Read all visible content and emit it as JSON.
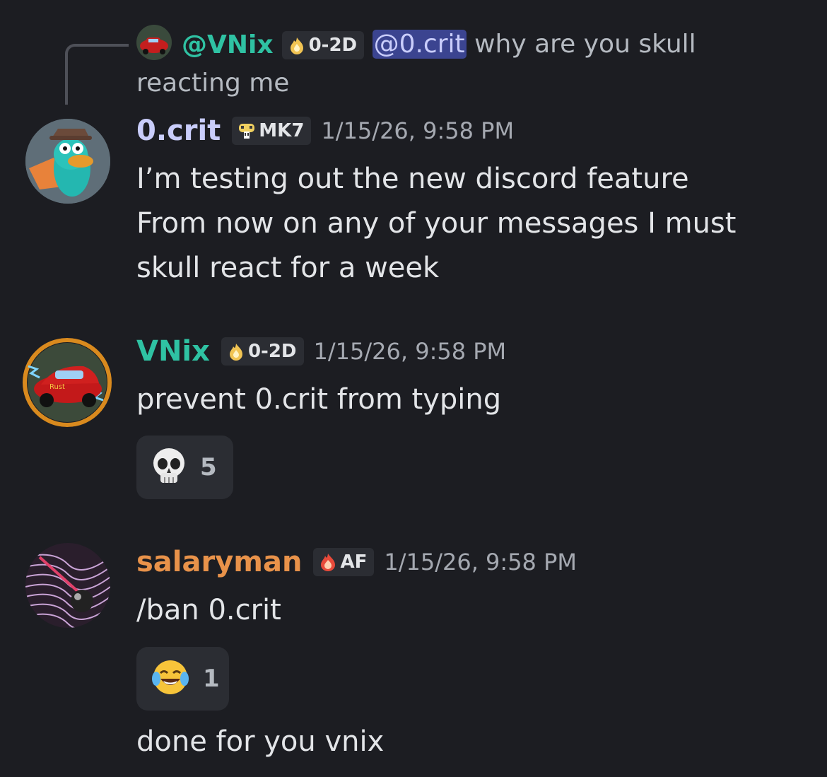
{
  "reply": {
    "author": "@VNix",
    "tag": "0-2D",
    "mention": "@0.crit",
    "text": " why are you skull reacting me"
  },
  "messages": [
    {
      "author": "0.crit",
      "author_color": "#c9cdfb",
      "tag": "MK7",
      "tag_icon": "mushroom-icon",
      "timestamp": "1/15/26, 9:58 PM",
      "lines": [
        "I’m testing out the new discord feature",
        "From now on any of your messages I must",
        "skull react for a week"
      ]
    },
    {
      "author": "VNix",
      "author_color": "#2fc2a3",
      "tag": "0-2D",
      "tag_icon": "flame-icon",
      "timestamp": "1/15/26, 9:58 PM",
      "lines": [
        "prevent 0.crit from typing"
      ],
      "reaction": {
        "emoji": "💀",
        "count": "5"
      }
    },
    {
      "author": "salaryman",
      "author_color": "#e8924a",
      "tag": "AF",
      "tag_icon": "fire-icon",
      "timestamp": "1/15/26, 9:58 PM",
      "lines": [
        "/ban 0.crit"
      ],
      "reaction": {
        "emoji": "😂",
        "count": "1"
      },
      "followup": "done for you vnix"
    }
  ]
}
